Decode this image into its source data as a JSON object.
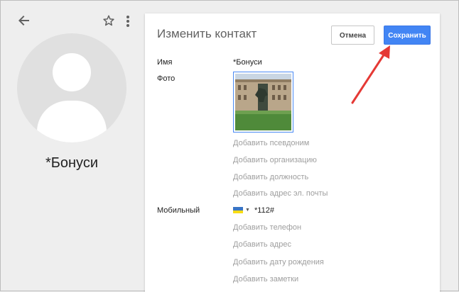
{
  "sidebar": {
    "contact_name": "*Бонуси"
  },
  "panel": {
    "title": "Изменить контакт",
    "cancel_label": "Отмена",
    "save_label": "Сохранить",
    "fields": {
      "name_label": "Имя",
      "name_value": "*Бонуси",
      "photo_label": "Фото",
      "mobile_label": "Мобильный",
      "mobile_value": "*112#"
    },
    "add_links": {
      "nickname": "Добавить псевдоним",
      "organization": "Добавить организацию",
      "position": "Добавить должность",
      "email": "Добавить адрес эл. почты",
      "phone": "Добавить телефон",
      "address": "Добавить адрес",
      "birthday": "Добавить дату рождения",
      "notes": "Добавить заметки"
    }
  },
  "icons": {
    "back": "arrow-back-icon",
    "star": "star-icon",
    "more": "more-vert-icon",
    "flag": "ukraine-flag-icon"
  },
  "colors": {
    "accent": "#4285f4",
    "annotation_arrow": "#e53935"
  }
}
